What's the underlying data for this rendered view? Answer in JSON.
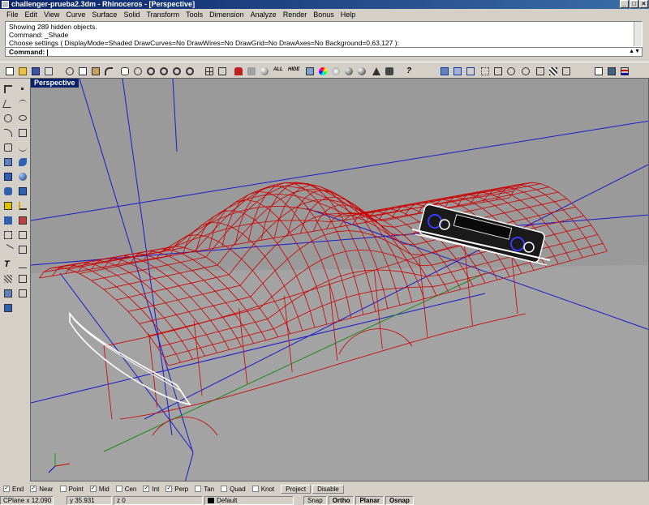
{
  "window": {
    "title": "challenger-prueba2.3dm - Rhinoceros - [Perspective]",
    "controls": [
      "_",
      "□",
      "×"
    ]
  },
  "menu": [
    "File",
    "Edit",
    "View",
    "Curve",
    "Surface",
    "Solid",
    "Transform",
    "Tools",
    "Dimension",
    "Analyze",
    "Render",
    "Bonus",
    "Help"
  ],
  "command_history": [
    "Showing 289 hidden objects.",
    "Command: _Shade",
    "Choose settings ( DisplayMode=Shaded  DrawCurves=No  DrawWires=No  DrawGrid=No  DrawAxes=No  Background=0,63,127 ):"
  ],
  "command_prompt": {
    "label": "Command:",
    "value": ""
  },
  "viewport": {
    "label": "Perspective",
    "background": "#9a9a9a"
  },
  "colors": {
    "wireframe": "#cc0000",
    "guides": "#1a1acc",
    "detail": "#ffffff"
  },
  "osnap": {
    "options": [
      {
        "label": "End",
        "checked": true
      },
      {
        "label": "Near",
        "checked": true
      },
      {
        "label": "Point",
        "checked": false
      },
      {
        "label": "Mid",
        "checked": true
      },
      {
        "label": "Cen",
        "checked": false
      },
      {
        "label": "Int",
        "checked": true
      },
      {
        "label": "Perp",
        "checked": true
      },
      {
        "label": "Tan",
        "checked": false
      },
      {
        "label": "Quad",
        "checked": false
      },
      {
        "label": "Knot",
        "checked": false
      }
    ],
    "project_label": "Project",
    "disable_label": "Disable"
  },
  "status": {
    "cplane": "CPlane",
    "x": "x 12.090",
    "y": "y 35.931",
    "z": "z 0",
    "layer": "Default",
    "snap": "Snap",
    "ortho": "Ortho",
    "planar": "Planar",
    "osnap": "Osnap"
  }
}
